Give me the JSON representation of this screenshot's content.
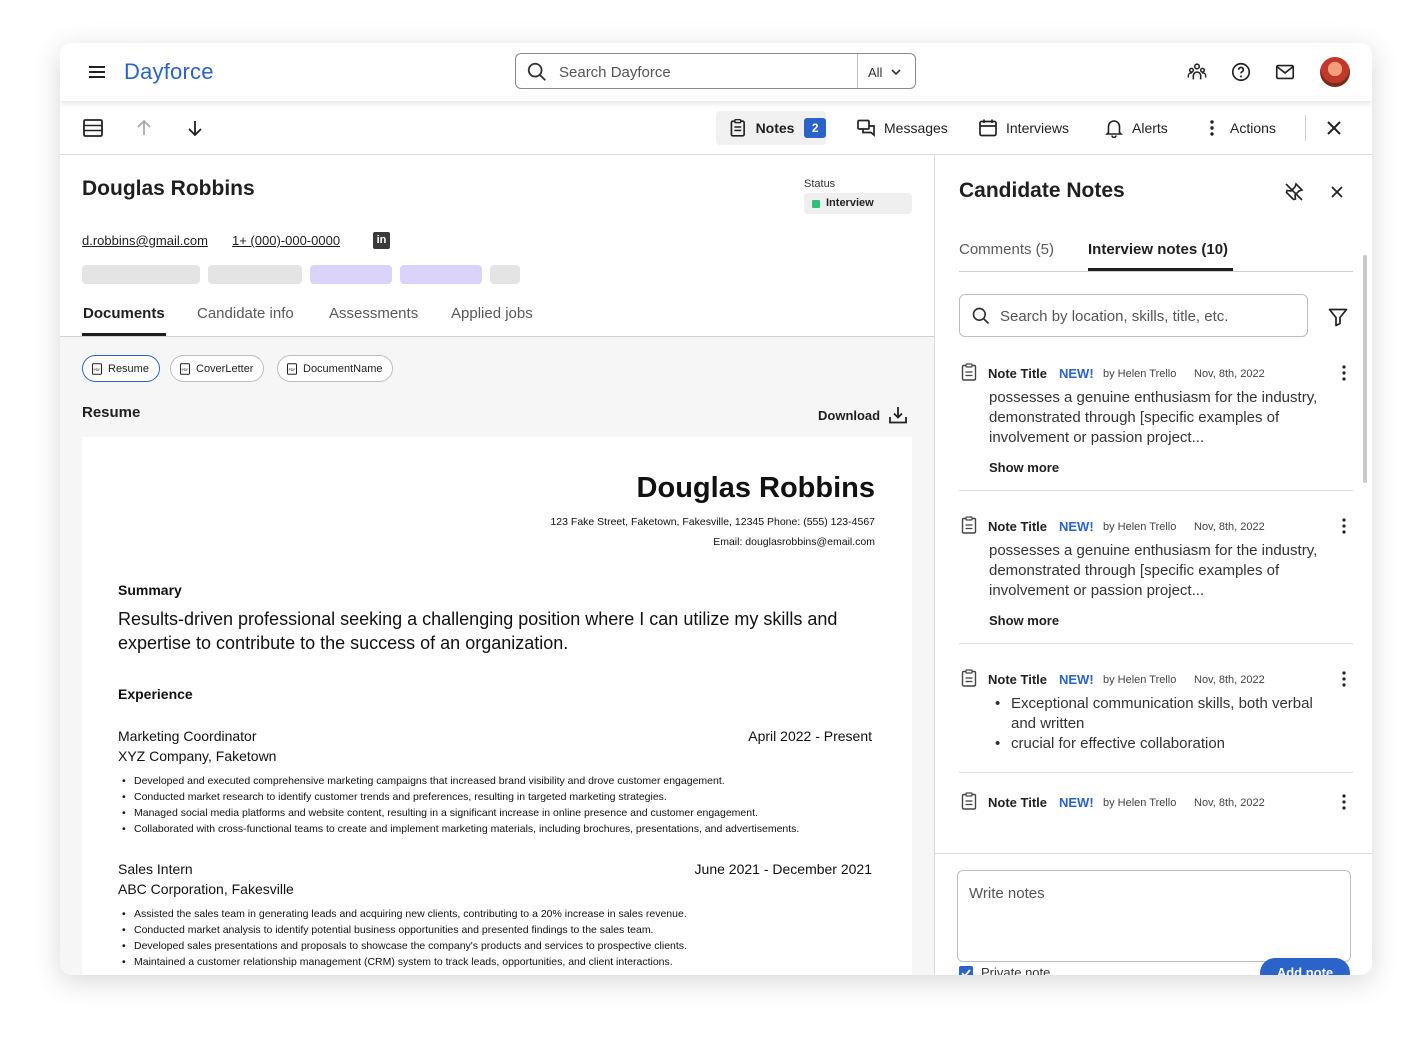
{
  "app": {
    "logo": "Dayforce"
  },
  "search": {
    "placeholder": "Search Dayforce",
    "scope": "All"
  },
  "toolbar": {
    "notes_label": "Notes",
    "notes_count": "2",
    "messages_label": "Messages",
    "interviews_label": "Interviews",
    "alerts_label": "Alerts",
    "actions_label": "Actions"
  },
  "candidate": {
    "name": "Douglas Robbins",
    "status_label": "Status",
    "status": "Interview",
    "email": "d.robbins@gmail.com",
    "phone": "1+ (000)-000-0000",
    "linkedin_glyph": "in"
  },
  "tabs": [
    "Documents",
    "Candidate info",
    "Assessments",
    "Applied jobs"
  ],
  "documents": {
    "chips": [
      "Resume",
      "CoverLetter",
      "DocumentName"
    ],
    "title": "Resume",
    "download_label": "Download"
  },
  "resume": {
    "name": "Douglas Robbins",
    "address": "123 Fake Street, Faketown, Fakesville, 12345 Phone: (555) 123-4567",
    "email": "Email: douglasrobbins@email.com",
    "summary_heading": "Summary",
    "summary": "Results-driven professional seeking a challenging position where I can utilize my skills and expertise to contribute to the success of an organization.",
    "experience_heading": "Experience",
    "jobs": [
      {
        "title": "Marketing Coordinator",
        "company": "XYZ Company, Faketown",
        "dates": "April 2022 - Present",
        "bullets": [
          "Developed and executed comprehensive marketing campaigns that increased brand visibility and drove customer engagement.",
          "Conducted market research to identify customer trends and preferences, resulting in targeted marketing strategies.",
          "Managed social media platforms and website content, resulting in a significant increase in online presence and customer engagement.",
          "Collaborated with cross-functional teams to create and implement marketing materials, including brochures, presentations, and advertisements."
        ]
      },
      {
        "title": "Sales Intern",
        "company": "ABC Corporation, Fakesville",
        "dates": "June 2021 - December 2021",
        "bullets": [
          "Assisted the sales team in generating leads and acquiring new clients, contributing to a 20% increase in sales revenue.",
          "Conducted market analysis to identify potential business opportunities and presented findings to the sales team.",
          "Developed sales presentations and proposals to showcase the company's products and services to prospective clients.",
          "Maintained a customer relationship management (CRM) system to track leads, opportunities, and client interactions."
        ]
      }
    ]
  },
  "notes_panel": {
    "title": "Candidate Notes",
    "tabs": [
      "Comments (5)",
      "Interview notes (10)"
    ],
    "search_placeholder": "Search by location, skills, title, etc.",
    "notes": [
      {
        "title": "Note Title",
        "new": "NEW!",
        "author": "by Helen Trello",
        "date": "Nov, 8th, 2022",
        "body": "possesses a genuine enthusiasm for the industry, demonstrated through [specific examples of involvement or passion project...",
        "show_more": "Show more"
      },
      {
        "title": "Note Title",
        "new": "NEW!",
        "author": "by Helen Trello",
        "date": "Nov, 8th, 2022",
        "body": "possesses a genuine enthusiasm for the industry, demonstrated through [specific examples of involvement or passion project...",
        "show_more": "Show more"
      },
      {
        "title": "Note Title",
        "new": "NEW!",
        "author": "by Helen Trello",
        "date": "Nov, 8th, 2022",
        "bullets": [
          "Exceptional communication skills, both verbal and written",
          "crucial for effective collaboration"
        ]
      },
      {
        "title": "Note Title",
        "new": "NEW!",
        "author": "by Helen Trello",
        "date": "Nov, 8th, 2022"
      }
    ],
    "composer_placeholder": "Write notes",
    "private_label": "Private note",
    "add_label": "Add note"
  },
  "colors": {
    "accent": "#2a64c8",
    "status_green": "#2ec27e",
    "skeleton_gray": "#e4e4e4",
    "skeleton_purple": "#dcd3fb"
  }
}
